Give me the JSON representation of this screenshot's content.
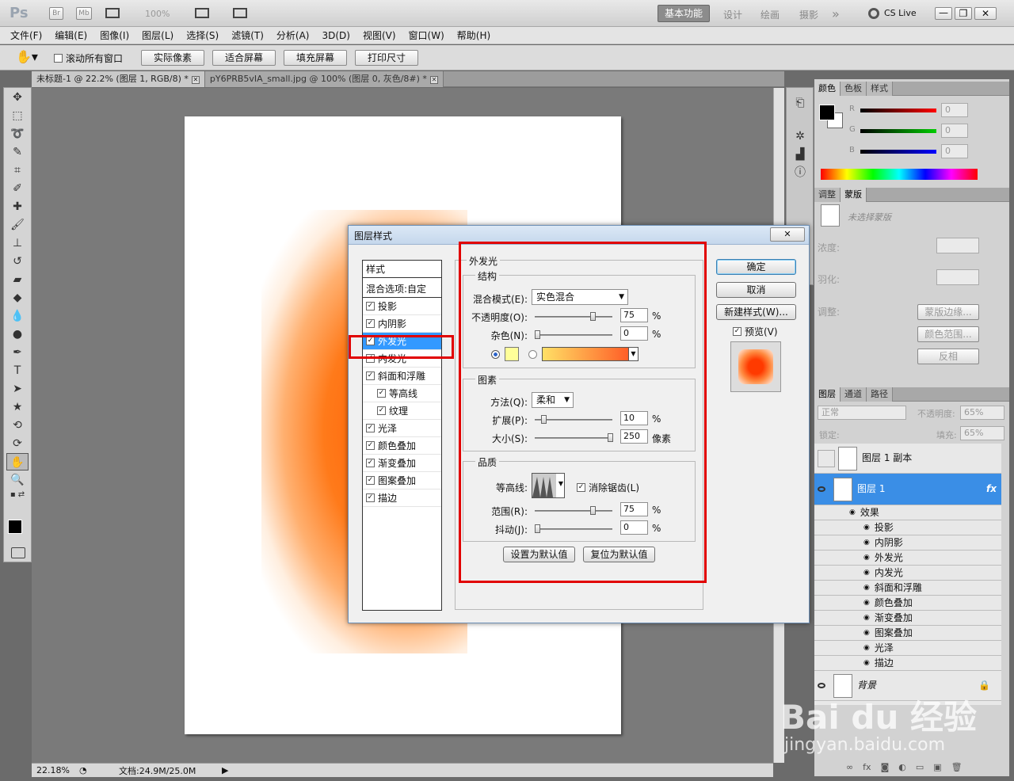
{
  "app": {
    "logo": "Ps",
    "br": "Br",
    "mb": "Mb",
    "zoom_display": "100%",
    "workspace_active": "基本功能",
    "workspaces": [
      "设计",
      "绘画",
      "摄影"
    ],
    "more": "»",
    "cslive": "CS Live"
  },
  "menu": [
    "文件(F)",
    "编辑(E)",
    "图像(I)",
    "图层(L)",
    "选择(S)",
    "滤镜(T)",
    "分析(A)",
    "3D(D)",
    "视图(V)",
    "窗口(W)",
    "帮助(H)"
  ],
  "options": {
    "scroll_all": "滚动所有窗口",
    "buttons": [
      "实际像素",
      "适合屏幕",
      "填充屏幕",
      "打印尺寸"
    ]
  },
  "tabs": [
    {
      "label": "未标题-1 @ 22.2% (图层 1, RGB/8) *",
      "active": true
    },
    {
      "label": "pY6PRB5vIA_small.jpg @ 100% (图层 0, 灰色/8#) *",
      "active": false
    }
  ],
  "status": {
    "zoom": "22.18%",
    "doc": "文档:24.9M/25.0M"
  },
  "color_panel": {
    "tabs": [
      "颜色",
      "色板",
      "样式"
    ],
    "channels": [
      {
        "name": "R",
        "value": "0"
      },
      {
        "name": "G",
        "value": "0"
      },
      {
        "name": "B",
        "value": "0"
      }
    ]
  },
  "adjust_panel": {
    "tabs": [
      "调整",
      "蒙版"
    ],
    "no_mask": "未选择蒙版",
    "density": "浓度:",
    "feather": "羽化:",
    "refine": "调整:",
    "mask_edge": "蒙版边缘...",
    "color_range": "颜色范围...",
    "invert": "反相"
  },
  "layers_panel": {
    "tabs": [
      "图层",
      "通道",
      "路径"
    ],
    "blend": "正常",
    "opacity_label": "不透明度:",
    "opacity": "65%",
    "lock_label": "锁定:",
    "fill_label": "填充:",
    "fill": "65%",
    "layers": [
      {
        "name": "图层 1 副本"
      },
      {
        "name": "图层 1",
        "fx": "fx"
      }
    ],
    "effects_title": "效果",
    "effects": [
      "投影",
      "内阴影",
      "外发光",
      "内发光",
      "斜面和浮雕",
      "颜色叠加",
      "渐变叠加",
      "图案叠加",
      "光泽",
      "描边"
    ],
    "background": "背景"
  },
  "dialog": {
    "title": "图层样式",
    "close": "✕",
    "styles_header": "样式",
    "blend_options": "混合选项:自定",
    "styles": [
      {
        "label": "投影",
        "checked": true
      },
      {
        "label": "内阴影",
        "checked": true
      },
      {
        "label": "外发光",
        "checked": true,
        "selected": true
      },
      {
        "label": "内发光",
        "checked": true
      },
      {
        "label": "斜面和浮雕",
        "checked": true
      },
      {
        "label": "等高线",
        "checked": true,
        "sub": true
      },
      {
        "label": "纹理",
        "checked": true,
        "sub": true
      },
      {
        "label": "光泽",
        "checked": true
      },
      {
        "label": "颜色叠加",
        "checked": true
      },
      {
        "label": "渐变叠加",
        "checked": true
      },
      {
        "label": "图案叠加",
        "checked": true
      },
      {
        "label": "描边",
        "checked": true
      }
    ],
    "section": "外发光",
    "structure": "结构",
    "blend_mode_label": "混合模式(E):",
    "blend_mode": "实色混合",
    "opacity_label": "不透明度(O):",
    "opacity": "75",
    "noise_label": "杂色(N):",
    "noise": "0",
    "elements": "图素",
    "method_label": "方法(Q):",
    "method": "柔和",
    "spread_label": "扩展(P):",
    "spread": "10",
    "size_label": "大小(S):",
    "size": "250",
    "px": "像素",
    "quality": "品质",
    "contour_label": "等高线:",
    "antialias": "消除锯齿(L)",
    "range_label": "范围(R):",
    "range": "75",
    "jitter_label": "抖动(J):",
    "jitter": "0",
    "pct": "%",
    "set_default": "设置为默认值",
    "reset_default": "复位为默认值",
    "ok": "确定",
    "cancel": "取消",
    "new_style": "新建样式(W)...",
    "preview": "预览(V)",
    "colors": {
      "glow": "#ffff99",
      "grad_start": "#ffe066",
      "grad_end": "#ff5020"
    }
  },
  "watermark": {
    "main": "Bai du 经验",
    "sub": "jingyan.baidu.com"
  }
}
